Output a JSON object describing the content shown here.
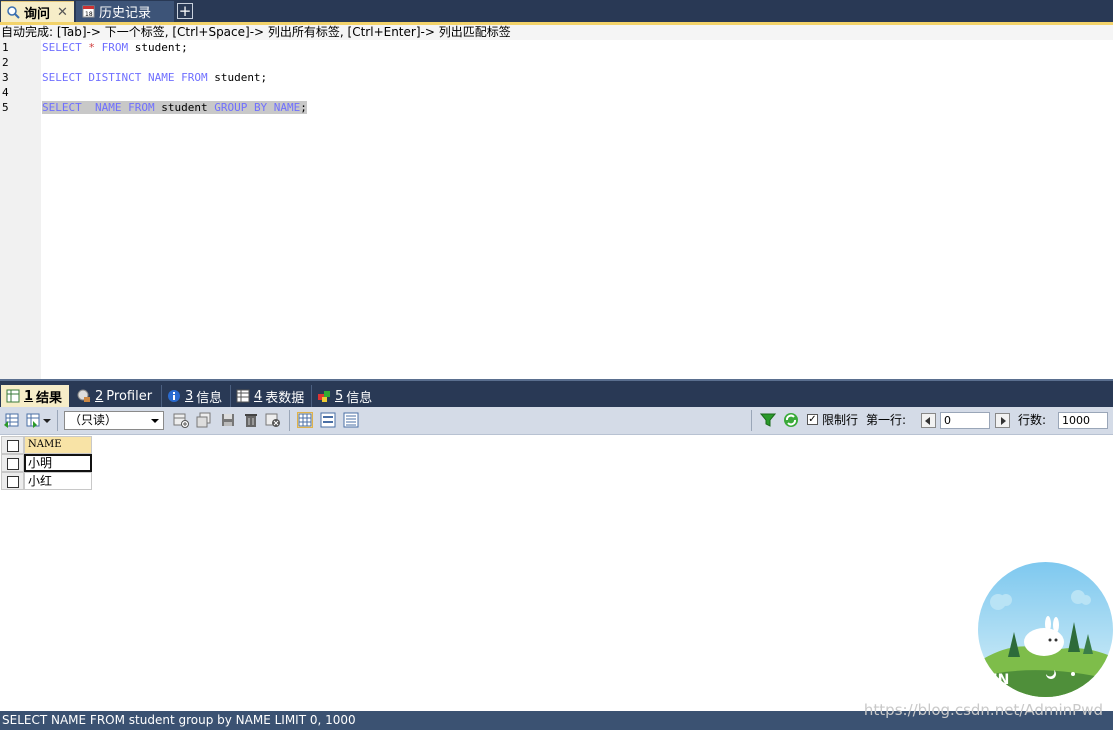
{
  "top_tabs": [
    {
      "label": "询问",
      "icon": "query-icon"
    },
    {
      "label": "历史记录",
      "icon": "history-icon"
    }
  ],
  "hint": "自动完成: [Tab]-> 下一个标签, [Ctrl+Space]-> 列出所有标签, [Ctrl+Enter]-> 列出匹配标签",
  "editor": {
    "line_numbers": [
      "1",
      "2",
      "3",
      "4",
      "5"
    ],
    "line1": {
      "kw1": "SELECT",
      "star": "*",
      "kw2": "FROM",
      "rest": " student;"
    },
    "line3": {
      "kw1": "SELECT DISTINCT NAME FROM",
      "rest": " student;"
    },
    "line5": {
      "kw1": "SELECT  NAME FROM",
      "mid": " student ",
      "kw2": "GROUP BY NAME",
      "end": ";"
    }
  },
  "result_tabs": [
    {
      "num": "1",
      "label": "结果"
    },
    {
      "num": "2",
      "label": "Profiler"
    },
    {
      "num": "3",
      "label": "信息"
    },
    {
      "num": "4",
      "label": "表数据"
    },
    {
      "num": "5",
      "label": "信息"
    }
  ],
  "toolbar": {
    "mode_select": "（只读）",
    "limit_label": "限制行",
    "limit_checked": true,
    "first_row_label": "第一行:",
    "first_row_value": "0",
    "row_count_label": "行数:",
    "row_count_value": "1000"
  },
  "grid": {
    "header": "NAME",
    "rows": [
      "小明",
      "小红"
    ]
  },
  "status": "SELECT NAME FROM student group by NAME LIMIT 0, 1000",
  "watermark": "https://blog.csdn.net/AdminPwd",
  "avatar_badge": "EN",
  "colors": {
    "tab_bar": "#293955",
    "active_tab": "#f6edc8",
    "keyword": "#6f6fff",
    "toolbar": "#d4dbe7",
    "status": "#3b5272"
  }
}
